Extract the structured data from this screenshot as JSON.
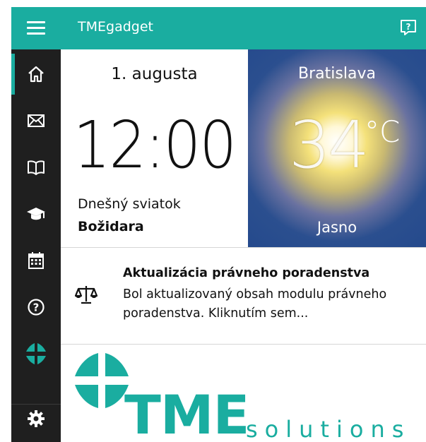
{
  "app": {
    "title": "TMEgadget",
    "accent_color": "#1aada0",
    "sidebar_bg": "#1f1f1f"
  },
  "titlebar_icons": {
    "menu": "hamburger-icon",
    "feedback": "feedback-icon"
  },
  "sidebar": {
    "items": [
      {
        "icon": "home-icon",
        "active": true
      },
      {
        "icon": "mail-icon",
        "active": false
      },
      {
        "icon": "book-icon",
        "active": false
      },
      {
        "icon": "graduation-cap-icon",
        "active": false
      },
      {
        "icon": "calendar-icon",
        "active": false
      },
      {
        "icon": "help-icon",
        "active": false
      },
      {
        "icon": "tme-logo-icon",
        "active": false
      },
      {
        "icon": "gear-icon",
        "active": false
      }
    ]
  },
  "date_tile": {
    "date": "1. augusta",
    "time": "12:00",
    "holiday_label": "Dnešný sviatok",
    "holiday_name": "Božidara"
  },
  "weather_tile": {
    "city": "Bratislava",
    "temperature": "34",
    "unit": "°C",
    "condition": "Jasno"
  },
  "notice": {
    "icon": "scales-icon",
    "title": "Aktualizácia právneho poradenstva",
    "body": "Bol aktualizovaný obsah modulu právneho poradenstva. Kliknutím sem..."
  },
  "logo": {
    "brand": "TME",
    "sub": "solutions"
  }
}
